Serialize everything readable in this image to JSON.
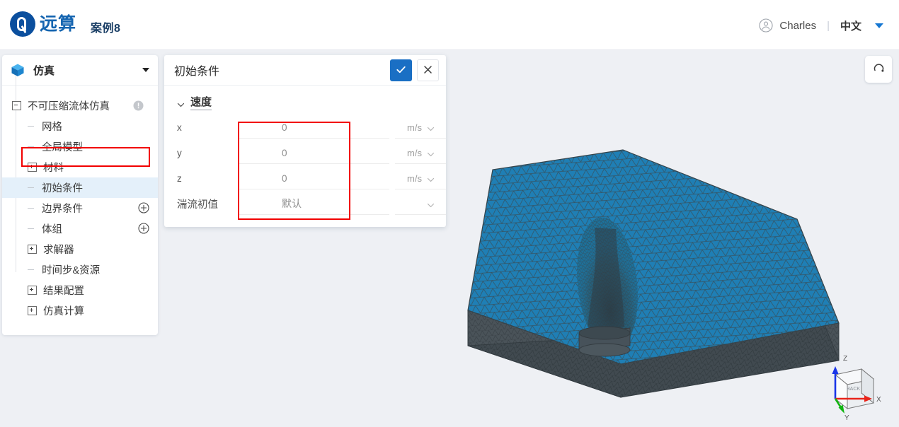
{
  "app": {
    "brand_text": "远算",
    "case_title": "案例8",
    "logo_icon": "logo-circle-icon"
  },
  "topbar": {
    "user_icon": "user-avatar-icon",
    "user_name": "Charles",
    "separator": "|",
    "language": "中文",
    "caret_icon": "caret-down-icon"
  },
  "sidebar": {
    "header": {
      "icon": "cube-icon",
      "label": "仿真",
      "caret_icon": "caret-down-icon"
    },
    "tree": [
      {
        "label": "不可压缩流体仿真",
        "type": "root",
        "toggle": "minus",
        "badge": "info-icon",
        "selected": false
      },
      {
        "label": "网格",
        "type": "child",
        "toggle": "leaf",
        "badge": null,
        "selected": false
      },
      {
        "label": "全局模型",
        "type": "child",
        "toggle": "leaf",
        "badge": null,
        "selected": false
      },
      {
        "label": "材料",
        "type": "child",
        "toggle": "plus",
        "badge": null,
        "selected": false
      },
      {
        "label": "初始条件",
        "type": "child",
        "toggle": "leaf",
        "badge": null,
        "selected": true
      },
      {
        "label": "边界条件",
        "type": "child",
        "toggle": "leaf",
        "badge": "add-icon",
        "selected": false
      },
      {
        "label": "体组",
        "type": "child",
        "toggle": "leaf",
        "badge": "add-icon",
        "selected": false
      },
      {
        "label": "求解器",
        "type": "child",
        "toggle": "plus",
        "badge": null,
        "selected": false
      },
      {
        "label": "时间步&资源",
        "type": "child",
        "toggle": "leaf",
        "badge": null,
        "selected": false
      },
      {
        "label": "结果配置",
        "type": "child",
        "toggle": "plus",
        "badge": null,
        "selected": false
      },
      {
        "label": "仿真计算",
        "type": "child",
        "toggle": "plus",
        "badge": null,
        "selected": false
      }
    ]
  },
  "panel": {
    "title": "初始条件",
    "confirm_icon": "check-icon",
    "cancel_icon": "close-icon",
    "section": {
      "chevron_icon": "chevron-down-icon",
      "label": "速度"
    },
    "rows": [
      {
        "label": "x",
        "value": "0",
        "unit": "m/s",
        "unit_chevron": "chevron-down-icon"
      },
      {
        "label": "y",
        "value": "0",
        "unit": "m/s",
        "unit_chevron": "chevron-down-icon"
      },
      {
        "label": "z",
        "value": "0",
        "unit": "m/s",
        "unit_chevron": "chevron-down-icon"
      },
      {
        "label": "湍流初值",
        "value": "默认",
        "unit": "",
        "unit_chevron": "chevron-down-icon"
      }
    ]
  },
  "viewport": {
    "home_button_icon": "reset-view-icon",
    "axis_gizmo": {
      "face_label": "BACK",
      "x_label": "X",
      "y_label": "Y",
      "z_label": "Z",
      "x_color": "#e8241a",
      "y_color": "#12b512",
      "z_color": "#1a35e8"
    },
    "mesh": {
      "top_face_color": "#1f7fb5",
      "side_face_color": "#4a5258",
      "wire_color": "#3d4449"
    }
  },
  "annotations": {
    "highlight_color": "#f20000",
    "selected_row_bg": "#e4f0fa"
  }
}
